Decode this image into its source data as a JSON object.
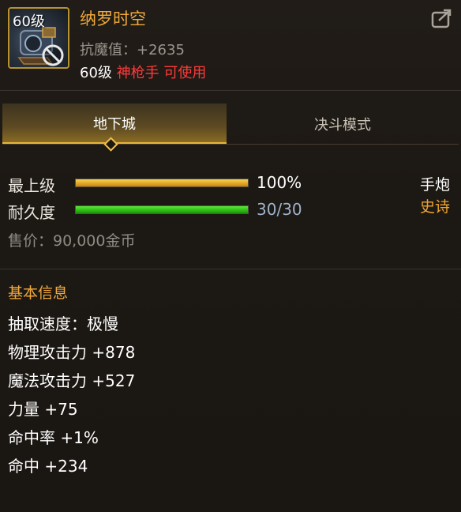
{
  "item": {
    "level_badge": "60级",
    "name": "纳罗时空",
    "stat_line": "抗魔值：+2635",
    "req_level": "60级",
    "req_class": "神枪手 可使用"
  },
  "tabs": [
    {
      "label": "地下城",
      "active": true
    },
    {
      "label": "决斗模式",
      "active": false
    }
  ],
  "grade": {
    "label": "最上级",
    "value": "100%",
    "percent": 100
  },
  "durability": {
    "label": "耐久度",
    "value": "30/30",
    "percent": 100
  },
  "weapon_type": "手炮",
  "rarity": "史诗",
  "price": "售价：90,000金币",
  "basic_info": {
    "title": "基本信息",
    "items": [
      "抽取速度：极慢",
      "物理攻击力 +878",
      "魔法攻击力 +527",
      "力量 +75",
      "命中率 +1%",
      "命中 +234"
    ]
  },
  "colors": {
    "name_orange": "#f2a93b",
    "class_red": "#ff3a3a",
    "grade_gold": "#e4a822",
    "durability_green": "#2fbe16"
  },
  "icons": [
    "weapon-item-icon",
    "no-entry-icon",
    "share-icon",
    "tab-diamond-icon"
  ]
}
